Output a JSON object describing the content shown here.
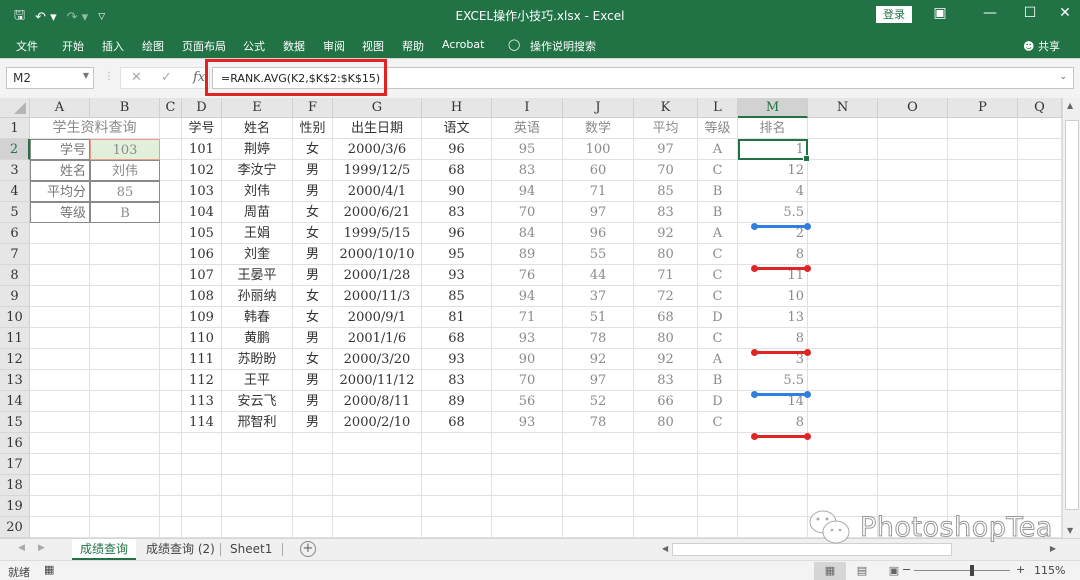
{
  "titlebar": {
    "title": "EXCEL操作小技巧.xlsx  -  Excel",
    "login": "登录",
    "qat_icons": [
      "save-icon",
      "undo-icon",
      "redo-icon",
      "customize-icon"
    ]
  },
  "ribbon": {
    "tabs": [
      "文件",
      "开始",
      "插入",
      "绘图",
      "页面布局",
      "公式",
      "数据",
      "审阅",
      "视图",
      "帮助",
      "Acrobat"
    ],
    "tell_me": "操作说明搜索",
    "share": "共享"
  },
  "formula_bar": {
    "name_box": "M2",
    "formula": "=RANK.AVG(K2,$K$2:$K$15)",
    "fx": "fx"
  },
  "columns": [
    "A",
    "B",
    "C",
    "D",
    "E",
    "F",
    "G",
    "H",
    "I",
    "J",
    "K",
    "L",
    "M",
    "N",
    "O",
    "P",
    "Q"
  ],
  "rows": [
    "1",
    "2",
    "3",
    "4",
    "5",
    "6",
    "7",
    "8",
    "9",
    "10",
    "11",
    "12",
    "13",
    "14",
    "15",
    "16",
    "17",
    "18",
    "19",
    "20"
  ],
  "lookup_panel": {
    "title": "学生资料查询",
    "fields": [
      {
        "label": "学号",
        "value": "103"
      },
      {
        "label": "姓名",
        "value": "刘伟"
      },
      {
        "label": "平均分",
        "value": "85"
      },
      {
        "label": "等级",
        "value": "B"
      }
    ]
  },
  "table": {
    "headers": [
      "学号",
      "姓名",
      "性别",
      "出生日期",
      "语文",
      "英语",
      "数学",
      "平均",
      "等级",
      "排名"
    ],
    "rows": [
      [
        "101",
        "荆婷",
        "女",
        "2000/3/6",
        "96",
        "95",
        "100",
        "97",
        "A",
        "1"
      ],
      [
        "102",
        "李汝宁",
        "男",
        "1999/12/5",
        "68",
        "83",
        "60",
        "70",
        "C",
        "12"
      ],
      [
        "103",
        "刘伟",
        "男",
        "2000/4/1",
        "90",
        "94",
        "71",
        "85",
        "B",
        "4"
      ],
      [
        "104",
        "周苗",
        "女",
        "2000/6/21",
        "83",
        "70",
        "97",
        "83",
        "B",
        "5.5"
      ],
      [
        "105",
        "王娟",
        "女",
        "1999/5/15",
        "96",
        "84",
        "96",
        "92",
        "A",
        "2"
      ],
      [
        "106",
        "刘奎",
        "男",
        "2000/10/10",
        "95",
        "89",
        "55",
        "80",
        "C",
        "8"
      ],
      [
        "107",
        "王晏平",
        "男",
        "2000/1/28",
        "93",
        "76",
        "44",
        "71",
        "C",
        "11"
      ],
      [
        "108",
        "孙丽纳",
        "女",
        "2000/11/3",
        "85",
        "94",
        "37",
        "72",
        "C",
        "10"
      ],
      [
        "109",
        "韩春",
        "女",
        "2000/9/1",
        "81",
        "71",
        "51",
        "68",
        "D",
        "13"
      ],
      [
        "110",
        "黄鹏",
        "男",
        "2001/1/6",
        "68",
        "93",
        "78",
        "80",
        "C",
        "8"
      ],
      [
        "111",
        "苏盼盼",
        "女",
        "2000/3/20",
        "93",
        "90",
        "92",
        "92",
        "A",
        "3"
      ],
      [
        "112",
        "王平",
        "男",
        "2000/11/12",
        "83",
        "70",
        "97",
        "83",
        "B",
        "5.5"
      ],
      [
        "113",
        "安云飞",
        "男",
        "2000/8/11",
        "89",
        "56",
        "52",
        "66",
        "D",
        "14"
      ],
      [
        "114",
        "邢智利",
        "男",
        "2000/2/10",
        "68",
        "93",
        "78",
        "80",
        "C",
        "8"
      ]
    ]
  },
  "annotations": {
    "blue": "#2f7fe0",
    "red": "#e02424",
    "blue_rows": [
      4,
      12
    ],
    "red_rows": [
      6,
      10,
      14
    ]
  },
  "sheets": {
    "tabs": [
      "成绩查询",
      "成绩查询 (2)",
      "Sheet1"
    ],
    "active": 0
  },
  "status": {
    "ready": "就绪",
    "zoom": "115%",
    "zoom_level_percent": 115
  },
  "watermark": "PhotoshopTea",
  "accent": "#217346"
}
